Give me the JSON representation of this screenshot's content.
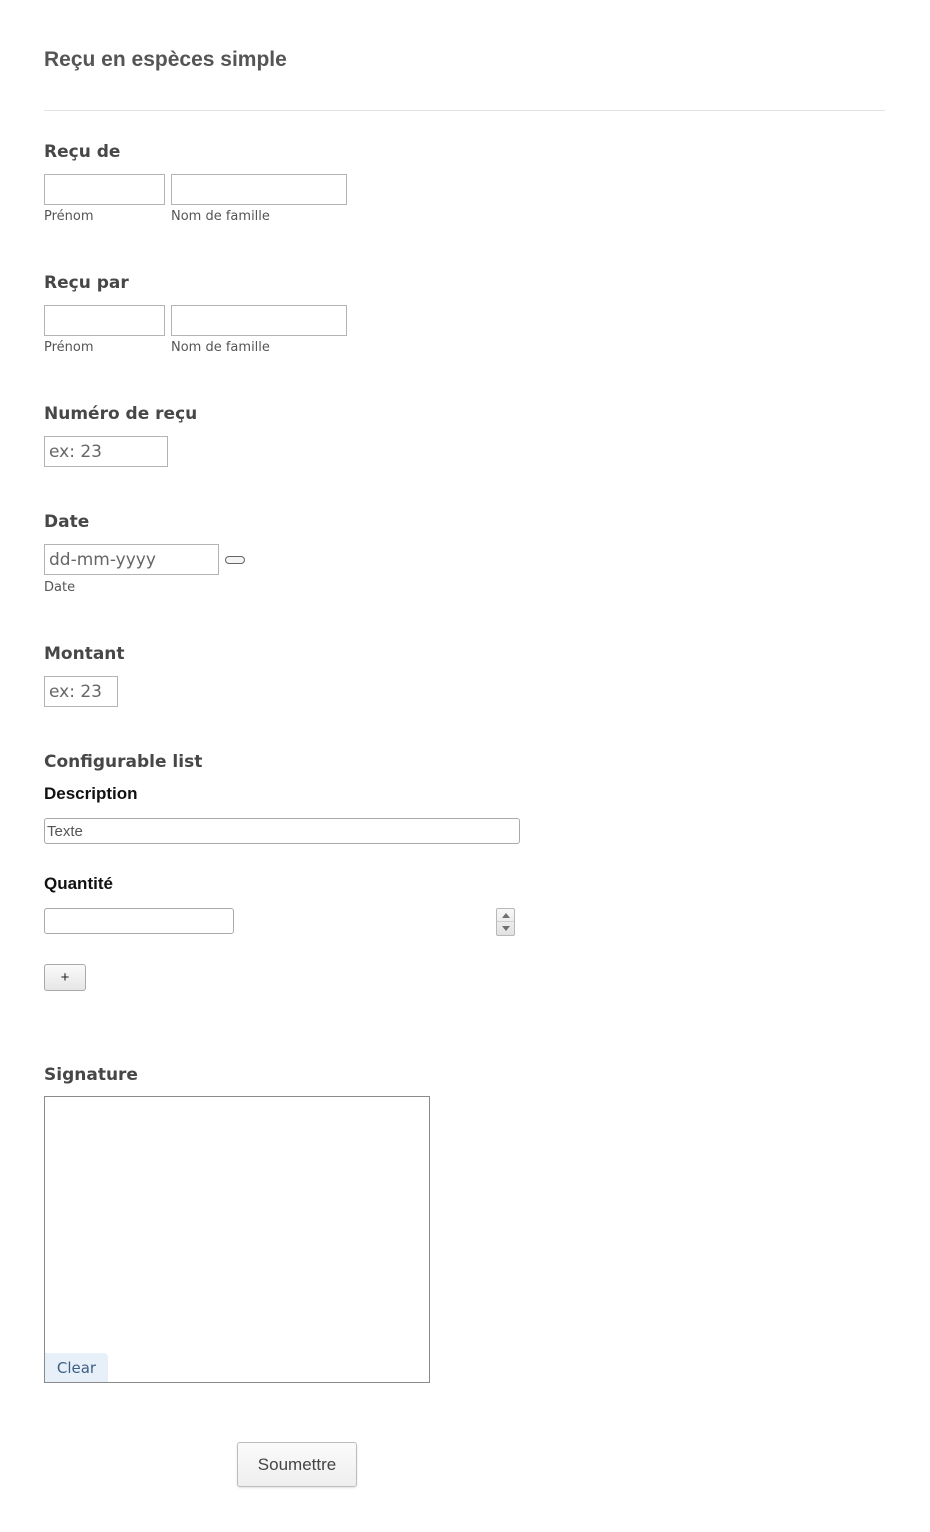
{
  "form": {
    "title": "Reçu en espèces simple"
  },
  "received_from": {
    "label": "Reçu de",
    "first_name_sublabel": "Prénom",
    "last_name_sublabel": "Nom de famille",
    "first_name_value": "",
    "last_name_value": ""
  },
  "received_by": {
    "label": "Reçu par",
    "first_name_sublabel": "Prénom",
    "last_name_sublabel": "Nom de famille",
    "first_name_value": "",
    "last_name_value": ""
  },
  "receipt_number": {
    "label": "Numéro de reçu",
    "placeholder": "ex: 23",
    "value": ""
  },
  "date": {
    "label": "Date",
    "placeholder": "dd-mm-yyyy",
    "sublabel": "Date",
    "value": "",
    "calendar_icon": "calendar-icon"
  },
  "amount": {
    "label": "Montant",
    "placeholder": "ex: 23",
    "value": ""
  },
  "configurable_list": {
    "label": "Configurable list",
    "description_label": "Description",
    "description_placeholder": "Texte",
    "description_value": "",
    "quantity_label": "Quantité",
    "quantity_value": "",
    "add_button_label": "+"
  },
  "signature": {
    "label": "Signature",
    "clear_label": "Clear"
  },
  "submit": {
    "label": "Soumettre"
  }
}
